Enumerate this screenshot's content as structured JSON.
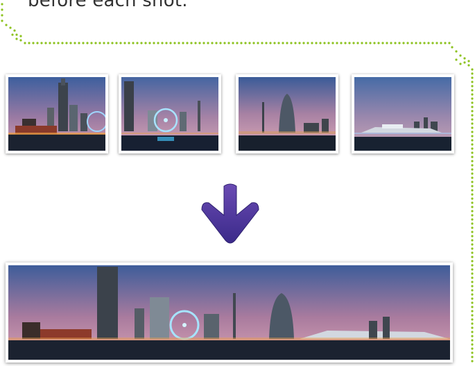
{
  "caption": {
    "text": "before each shot."
  },
  "colors": {
    "guide_dots": "#8dc21f",
    "arrow_top": "#6a4bb3",
    "arrow_bottom": "#3b2a8a",
    "sky_top": "#3e5d9a",
    "sky_mid": "#a97b9e",
    "sky_low": "#d7a3b5",
    "water": "#1b2230"
  },
  "images": {
    "thumbnails": [
      {
        "name": "photo-1",
        "scene": "skyscraper-left"
      },
      {
        "name": "photo-2",
        "scene": "tower-ferris-wheel"
      },
      {
        "name": "photo-3",
        "scene": "sail-hotel"
      },
      {
        "name": "photo-4",
        "scene": "harbor-ship"
      }
    ],
    "panorama": {
      "name": "stitched-panorama"
    }
  },
  "icons": {
    "arrow": "arrow-down-icon"
  }
}
